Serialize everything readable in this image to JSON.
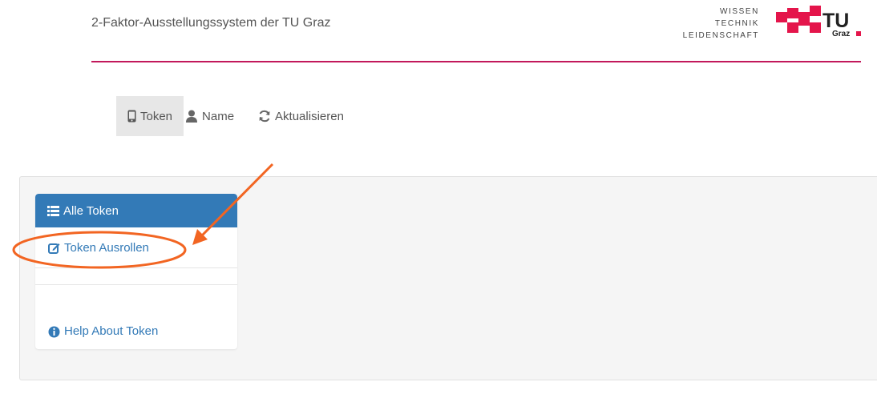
{
  "header": {
    "title": "2-Faktor-Ausstellungssystem der TU Graz",
    "tagline": [
      "WISSEN",
      "TECHNIK",
      "LEIDENSCHAFT"
    ],
    "logo": {
      "text_main": "TU",
      "text_sub": "Graz",
      "color": "#e4154b"
    },
    "rule_color": "#c2185b"
  },
  "nav": {
    "items": [
      {
        "label": "Token",
        "icon": "mobile-icon",
        "active": true
      },
      {
        "label": "Name",
        "icon": "user-icon",
        "active": false
      },
      {
        "label": "Aktualisieren",
        "icon": "refresh-icon",
        "active": false
      }
    ]
  },
  "sidebar": {
    "items": [
      {
        "label": "Alle Token",
        "icon": "list-icon",
        "active": true
      },
      {
        "label": "Token Ausrollen",
        "icon": "edit-icon",
        "active": false
      },
      {
        "label": "Help About Token",
        "icon": "info-icon",
        "active": false
      }
    ],
    "accent": "#337ab7"
  },
  "annotation": {
    "color": "#f26522"
  }
}
